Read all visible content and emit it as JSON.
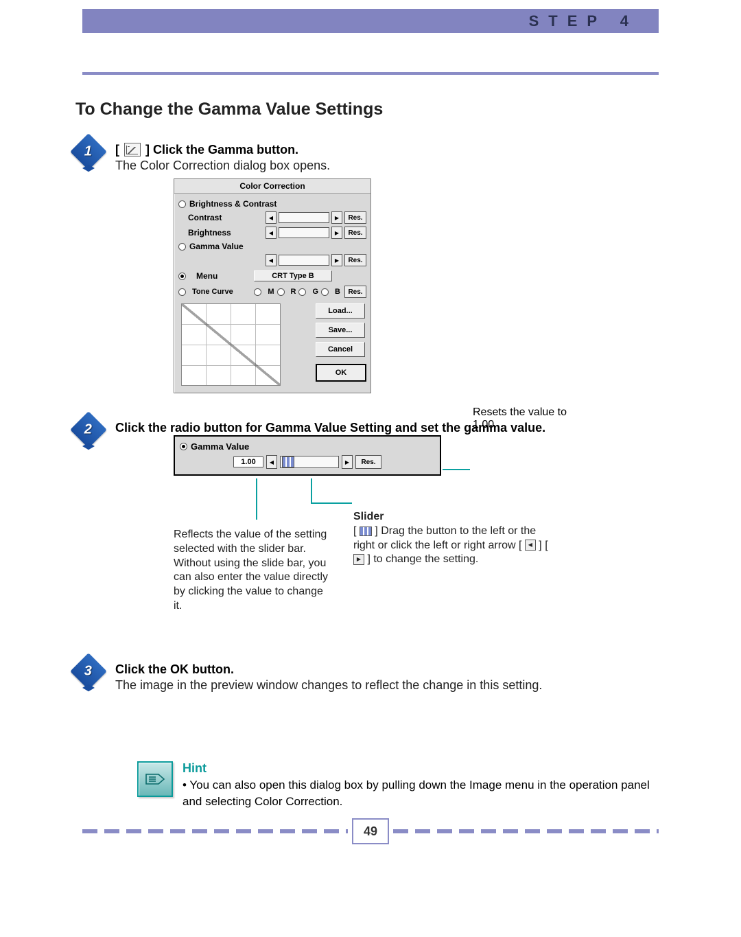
{
  "header": {
    "step_label": "STEP 4"
  },
  "section_title": "To Change the Gamma Value Settings",
  "steps": {
    "1": {
      "prefix_open": "[",
      "prefix_close": "] ",
      "title": "Click the Gamma button.",
      "sub": "The Color Correction dialog box opens."
    },
    "2": {
      "title": "Click the radio button for Gamma Value Setting and set the gamma value."
    },
    "3": {
      "title": "Click the OK button.",
      "sub": "The image in the preview window changes to reflect the change in this setting."
    }
  },
  "dialog": {
    "title": "Color Correction",
    "brightness_contrast": {
      "radio_label": "Brightness & Contrast",
      "rows": {
        "contrast_label": "Contrast",
        "brightness_label": "Brightness"
      }
    },
    "gamma": {
      "radio_label": "Gamma Value"
    },
    "menu": {
      "radio_label": "Menu",
      "dropdown_value": "CRT Type B"
    },
    "tone_curve": {
      "radio_label": "Tone Curve",
      "channels": [
        "M",
        "R",
        "G",
        "B"
      ]
    },
    "buttons": {
      "res": "Res.",
      "load": "Load...",
      "save": "Save...",
      "cancel": "Cancel",
      "ok": "OK"
    }
  },
  "zoom": {
    "radio_label": "Gamma Value",
    "value": "1.00",
    "res": "Res."
  },
  "annotations": {
    "reset": "Resets the value to 1.00",
    "slider_title": "Slider",
    "slider_body_a": "[ ",
    "slider_body_b": " ] Drag the button to the left or the right or click the left or right arrow [ ",
    "slider_body_c": " ] [ ",
    "slider_body_d": " ] to change the setting.",
    "value_body": "Reflects the value of the setting selected with the slider bar. Without using the slide bar, you can also enter the value directly by clicking the value to change it."
  },
  "hint": {
    "title": "Hint",
    "body": "• You can also open this dialog box by pulling down the Image menu in the operation panel and selecting Color Correction."
  },
  "page_number": "49"
}
